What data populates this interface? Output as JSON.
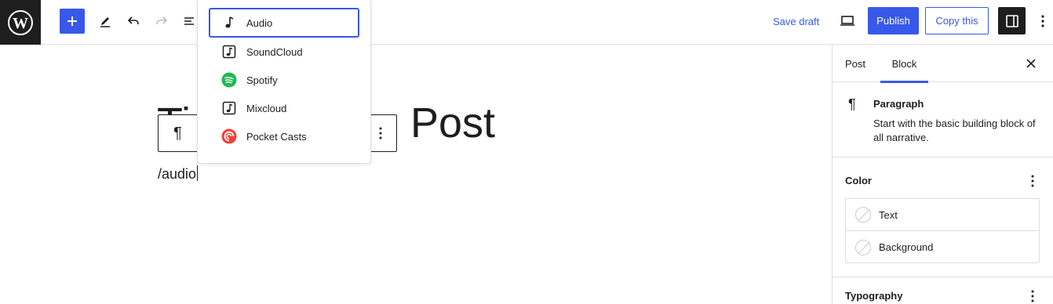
{
  "header": {
    "logo_icon": "wordpress-logo-icon",
    "add_block_icon": "plus-icon",
    "tools_icon": "pencil-icon",
    "undo_icon": "undo-icon",
    "redo_icon": "redo-icon",
    "list_view_icon": "list-view-icon",
    "save_draft_label": "Save draft",
    "preview_icon": "desktop-preview-icon",
    "publish_label": "Publish",
    "copy_label": "Copy this",
    "settings_icon": "sidebar-toggle-icon",
    "more_icon": "vertical-ellipsis-icon"
  },
  "editor": {
    "title_text": "Ti",
    "title_suffix": "Post",
    "paragraph_icon": "¶",
    "paragraph_text": "/audio"
  },
  "autocomplete": {
    "items": [
      {
        "label": "Audio",
        "icon": "audio-note-icon",
        "selected": true
      },
      {
        "label": "SoundCloud",
        "icon": "soundcloud-icon",
        "selected": false
      },
      {
        "label": "Spotify",
        "icon": "spotify-icon",
        "selected": false
      },
      {
        "label": "Mixcloud",
        "icon": "mixcloud-icon",
        "selected": false
      },
      {
        "label": "Pocket Casts",
        "icon": "pocket-casts-icon",
        "selected": false
      }
    ]
  },
  "sidebar": {
    "tabs": [
      {
        "label": "Post",
        "active": false
      },
      {
        "label": "Block",
        "active": true
      }
    ],
    "close_icon": "close-icon",
    "block_card": {
      "icon": "¶",
      "title": "Paragraph",
      "description": "Start with the basic building block of all narrative."
    },
    "color_panel": {
      "title": "Color",
      "items": [
        {
          "label": "Text"
        },
        {
          "label": "Background"
        }
      ]
    },
    "typography_panel": {
      "title": "Typography"
    }
  },
  "colors": {
    "accent": "#3858e9",
    "dark": "#1e1e1e",
    "spotify": "#1db954",
    "pocket_casts": "#f43e37"
  }
}
